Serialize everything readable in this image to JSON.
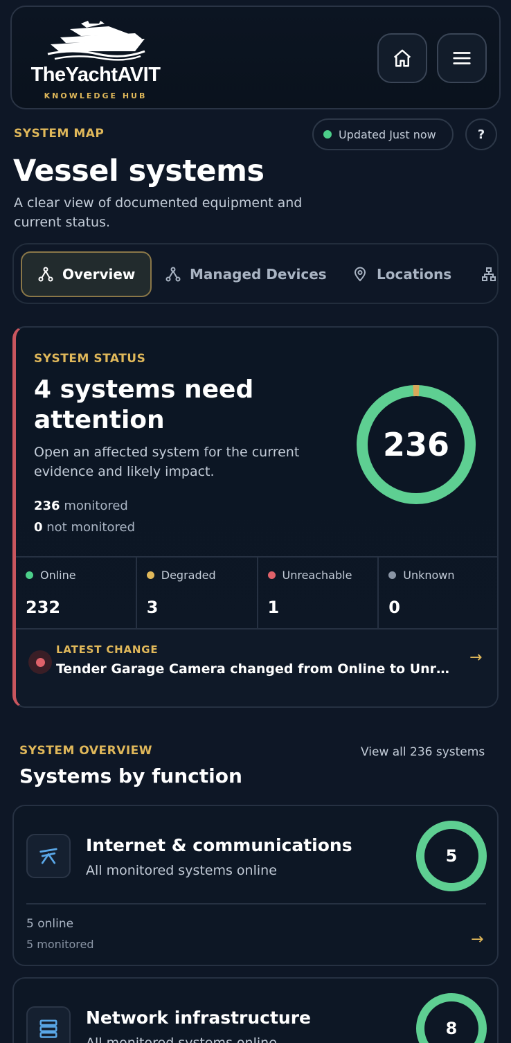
{
  "header": {
    "logo_title": "TheYachtAVIT",
    "logo_subtitle": "KNOWLEDGE HUB",
    "home_icon": "home-icon",
    "menu_icon": "menu-icon"
  },
  "system_map": {
    "eyebrow": "SYSTEM MAP",
    "updated_label": "Updated Just now",
    "help_label": "?",
    "title": "Vessel systems",
    "subtitle": "A clear view of documented equipment and current status."
  },
  "tabs": [
    {
      "label": "Overview",
      "icon": "network-icon",
      "active": true
    },
    {
      "label": "Managed Devices",
      "icon": "network-icon",
      "active": false
    },
    {
      "label": "Locations",
      "icon": "location-pin-icon",
      "active": false
    },
    {
      "label": "",
      "icon": "hierarchy-icon",
      "active": false
    }
  ],
  "status": {
    "eyebrow": "SYSTEM STATUS",
    "title": "4 systems need attention",
    "description": "Open an affected system for the current evidence and likely impact.",
    "monitored_value": "236",
    "monitored_label": "monitored",
    "not_monitored_value": "0",
    "not_monitored_label": "not monitored",
    "ring_total": "236",
    "ring_online_fraction": 0.983,
    "stats": [
      {
        "label": "Online",
        "value": "232",
        "color": "#4ccf8a"
      },
      {
        "label": "Degraded",
        "value": "3",
        "color": "#e0b85a"
      },
      {
        "label": "Unreachable",
        "value": "1",
        "color": "#e0626a"
      },
      {
        "label": "Unknown",
        "value": "0",
        "color": "#8a95a5"
      }
    ],
    "latest_eyebrow": "LATEST CHANGE",
    "latest_text": "Tender Garage Camera changed from Online to Unreachable"
  },
  "overview": {
    "eyebrow": "SYSTEM OVERVIEW",
    "view_all": "View all 236 systems",
    "title": "Systems by function",
    "cards": [
      {
        "name": "Internet & communications",
        "status": "All monitored systems online",
        "count": "5",
        "online": "5 online",
        "monitored": "5 monitored",
        "icon": "satellite-icon"
      },
      {
        "name": "Network infrastructure",
        "status": "All monitored systems online",
        "count": "8",
        "icon": "server-icon"
      }
    ]
  },
  "colors": {
    "accent": "#e0b85a",
    "online": "#5ecf92",
    "alert": "#c9565e",
    "background": "#0e1726"
  }
}
